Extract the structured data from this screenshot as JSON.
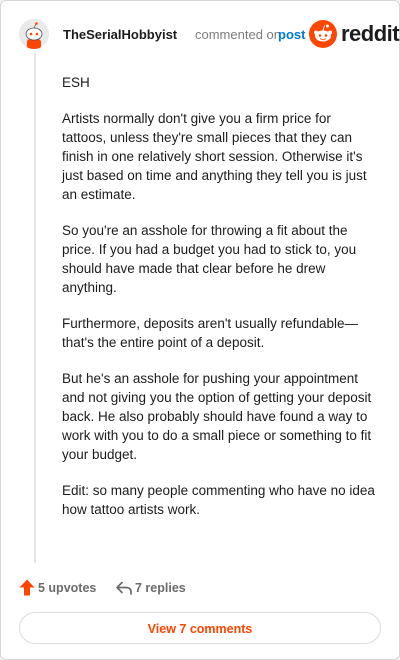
{
  "comment": {
    "author": "TheSerialHobbyist",
    "action_text": "commented on",
    "post_link": "post",
    "paragraphs": [
      "ESH",
      "Artists normally don't give you a firm price for tattoos, unless they're small pieces that they can finish in one relatively short session. Otherwise it's just based on time and anything they tell you is just an estimate.",
      "So you're an asshole for throwing a fit about the price. If you had a budget you had to stick to, you should have made that clear before he drew anything.",
      "Furthermore, deposits aren't usually refundable—that's the entire point of a deposit.",
      "But he's an asshole for pushing your appointment and not giving you the option of getting your deposit back. He also probably should have found a way to work with you to do a small piece or something to fit your budget.",
      "Edit: so many people commenting who have no idea how tattoo artists work."
    ],
    "upvotes": "5 upvotes",
    "replies": "7 replies",
    "view_comments": "View 7 comments"
  },
  "brand": {
    "logo_text": "reddit",
    "accent_color": "#ff4500",
    "link_color": "#0079d3"
  },
  "icons": {
    "avatar": "snoo-avatar",
    "logo": "reddit-alien-icon",
    "upvote": "upvote-arrow-icon",
    "reply": "reply-arrow-icon"
  }
}
